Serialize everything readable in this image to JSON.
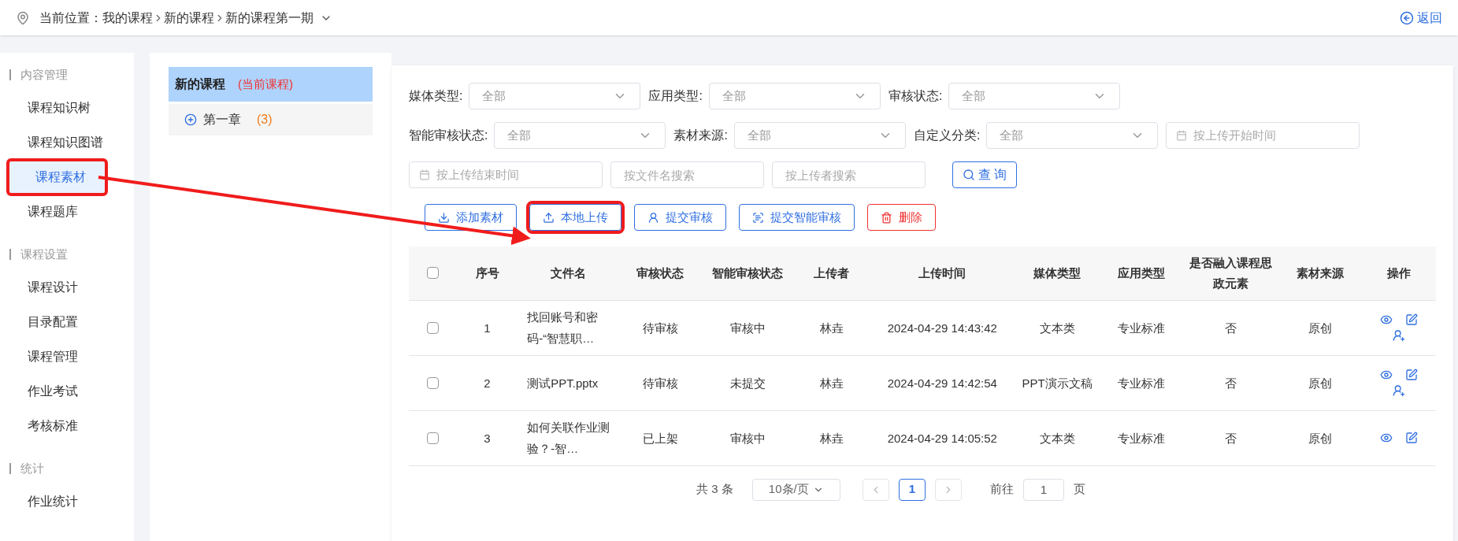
{
  "breadcrumb": {
    "label": "当前位置：",
    "items": [
      "我的课程",
      "新的课程",
      "新的课程第一期"
    ],
    "back": "返回"
  },
  "sidebar": {
    "sections": [
      {
        "title": "内容管理",
        "items": [
          {
            "label": "课程知识树",
            "selected": false,
            "annotated": false
          },
          {
            "label": "课程知识图谱",
            "selected": false,
            "annotated": false
          },
          {
            "label": "课程素材",
            "selected": true,
            "annotated": true
          },
          {
            "label": "课程题库",
            "selected": false,
            "annotated": false
          }
        ]
      },
      {
        "title": "课程设置",
        "items": [
          {
            "label": "课程设计",
            "selected": false,
            "annotated": false
          },
          {
            "label": "目录配置",
            "selected": false,
            "annotated": false
          },
          {
            "label": "课程管理",
            "selected": false,
            "annotated": false
          },
          {
            "label": "作业考试",
            "selected": false,
            "annotated": false
          },
          {
            "label": "考核标准",
            "selected": false,
            "annotated": false
          }
        ]
      },
      {
        "title": "统计",
        "items": [
          {
            "label": "作业统计",
            "selected": false,
            "annotated": false
          }
        ]
      }
    ]
  },
  "tree": {
    "root": {
      "title": "新的课程",
      "tag": "(当前课程)",
      "selected": true
    },
    "children": [
      {
        "label": "第一章",
        "count": "(3)"
      }
    ]
  },
  "filter_rows": [
    [
      {
        "kind": "select",
        "label": "媒体类型:",
        "value": "全部"
      },
      {
        "kind": "select",
        "label": "应用类型:",
        "value": "全部"
      },
      {
        "kind": "select",
        "label": "审核状态:",
        "value": "全部"
      }
    ],
    [
      {
        "kind": "select",
        "label": "智能审核状态:",
        "value": "全部"
      },
      {
        "kind": "select",
        "label": "素材来源:",
        "value": "全部"
      },
      {
        "kind": "select",
        "label": "自定义分类:",
        "value": "全部"
      },
      {
        "kind": "date",
        "placeholder": "按上传开始时间"
      }
    ],
    [
      {
        "kind": "date",
        "placeholder": "按上传结束时间"
      },
      {
        "kind": "text",
        "placeholder": "按文件名搜索"
      },
      {
        "kind": "text",
        "placeholder": "按上传者搜索"
      },
      {
        "kind": "query",
        "label": "查 询"
      }
    ]
  ],
  "actions": [
    {
      "kind": "add",
      "label": "添加素材",
      "annotated": false
    },
    {
      "kind": "upload",
      "label": "本地上传",
      "annotated": true
    },
    {
      "kind": "submit",
      "label": "提交审核",
      "annotated": false
    },
    {
      "kind": "ai",
      "label": "提交智能审核",
      "annotated": false
    },
    {
      "kind": "delete",
      "label": "删除",
      "annotated": false
    }
  ],
  "annotation": {
    "arrow": true
  },
  "table": {
    "all_checked": false,
    "columns": [
      "序号",
      "文件名",
      "审核状态",
      "智能审核状态",
      "上传者",
      "上传时间",
      "媒体类型",
      "应用类型",
      "是否融入课程思政元素",
      "素材来源",
      "操作"
    ],
    "rows": [
      {
        "checked": false,
        "cells": [
          "1",
          "找回账号和密码-“智慧职…",
          "待审核",
          "审核中",
          "林垚",
          "2024-04-29 14:43:42",
          "文本类",
          "专业标准",
          "否",
          "原创"
        ],
        "ops": [
          {
            "kind": "view"
          },
          {
            "kind": "edit"
          },
          {
            "kind": "assign"
          }
        ]
      },
      {
        "checked": false,
        "cells": [
          "2",
          "测试PPT.pptx",
          "待审核",
          "未提交",
          "林垚",
          "2024-04-29 14:42:54",
          "PPT演示文稿",
          "专业标准",
          "否",
          "原创"
        ],
        "ops": [
          {
            "kind": "view"
          },
          {
            "kind": "edit"
          },
          {
            "kind": "assign"
          }
        ]
      },
      {
        "checked": false,
        "cells": [
          "3",
          "如何关联作业测验？-智…",
          "已上架",
          "审核中",
          "林垚",
          "2024-04-29 14:05:52",
          "文本类",
          "专业标准",
          "否",
          "原创"
        ],
        "ops": [
          {
            "kind": "view"
          },
          {
            "kind": "edit"
          }
        ]
      }
    ]
  },
  "pagination": {
    "total": "共 3 条",
    "page_size": "10条/页",
    "pages": [
      {
        "label": "1",
        "selected": true
      }
    ],
    "goto_label": "前往",
    "goto_value": "1",
    "page_unit": "页"
  }
}
